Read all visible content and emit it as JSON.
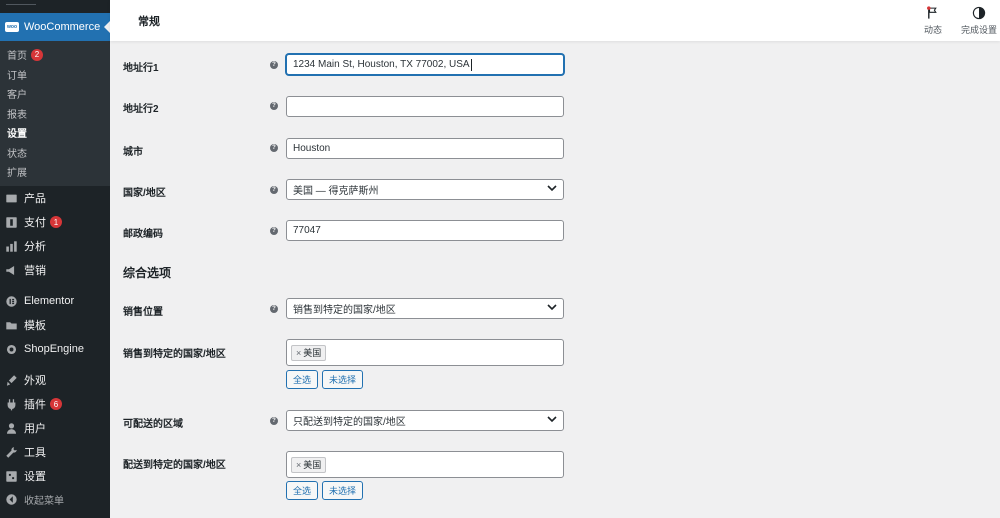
{
  "sidebar": {
    "plugin_title": "WooCommerce",
    "logo_text": "woo",
    "submenu": [
      {
        "label": "首页",
        "badge": "2"
      },
      {
        "label": "订单"
      },
      {
        "label": "客户"
      },
      {
        "label": "报表"
      },
      {
        "label": "设置",
        "current": true
      },
      {
        "label": "状态"
      },
      {
        "label": "扩展"
      }
    ],
    "menu": [
      {
        "label": "产品",
        "icon": "products-icon"
      },
      {
        "label": "支付",
        "icon": "payments-icon",
        "badge": "1"
      },
      {
        "label": "分析",
        "icon": "analytics-icon"
      },
      {
        "label": "营销",
        "icon": "marketing-icon"
      },
      {
        "label": "Elementor",
        "icon": "elementor-icon"
      },
      {
        "label": "模板",
        "icon": "templates-icon"
      },
      {
        "label": "ShopEngine",
        "icon": "shopengine-icon"
      },
      {
        "label": "外观",
        "icon": "appearance-icon"
      },
      {
        "label": "插件",
        "icon": "plugins-icon",
        "badge": "6"
      },
      {
        "label": "用户",
        "icon": "users-icon"
      },
      {
        "label": "工具",
        "icon": "tools-icon"
      },
      {
        "label": "设置",
        "icon": "settings-icon"
      },
      {
        "label": "收起菜单",
        "icon": "collapse-icon"
      }
    ]
  },
  "header": {
    "title": "常规",
    "activity_label": "动态",
    "finish_setup_label": "完成设置"
  },
  "form": {
    "address1": {
      "label": "地址行1",
      "value": "1234 Main St, Houston, TX 77002, USA"
    },
    "address2": {
      "label": "地址行2",
      "value": ""
    },
    "city": {
      "label": "城市",
      "value": "Houston"
    },
    "country": {
      "label": "国家/地区",
      "value": "美国 — 得克萨斯州"
    },
    "postcode": {
      "label": "邮政编码",
      "value": "77047"
    }
  },
  "general_options": {
    "section_title": "综合选项",
    "selling_location": {
      "label": "销售位置",
      "value": "销售到特定的国家/地区"
    },
    "sell_to_specific": {
      "label": "销售到特定的国家/地区",
      "chips": [
        "美国"
      ],
      "select_all": "全选",
      "select_none": "未选择"
    },
    "shipping_location": {
      "label": "可配送的区域",
      "value": "只配送到特定的国家/地区"
    },
    "ship_to_specific": {
      "label": "配送到特定的国家/地区",
      "chips": [
        "美国"
      ],
      "select_all": "全选",
      "select_none": "未选择"
    }
  },
  "colors": {
    "sidebar": "#1d2327",
    "submenu": "#2c3338",
    "accent": "#2271b1",
    "badge": "#d63638"
  }
}
